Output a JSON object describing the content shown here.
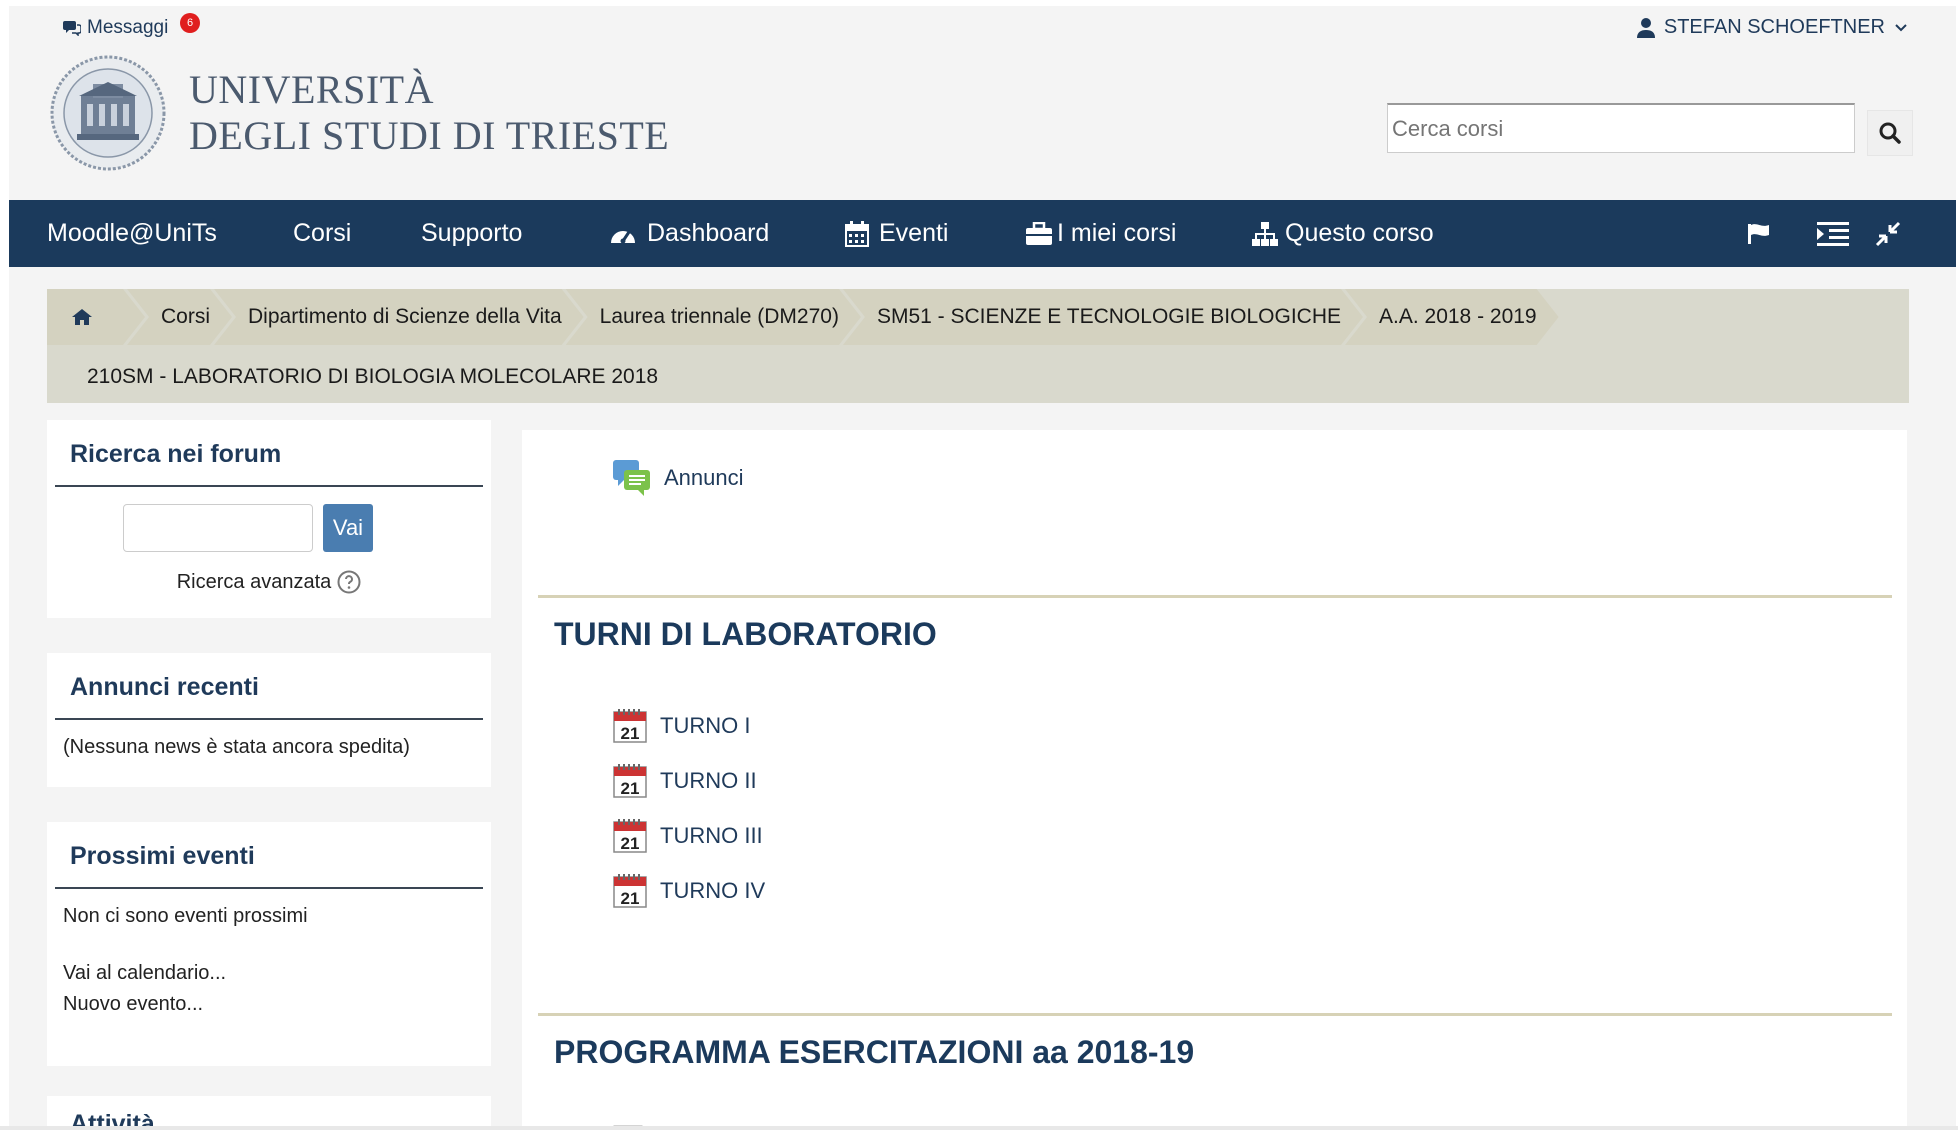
{
  "header": {
    "messages_label": "Messaggi",
    "messages_count": "6",
    "user_name": "STEFAN SCHOEFTNER",
    "logo_line1": "UNIVERSITÀ",
    "logo_line2": "DEGLI STUDI DI TRIESTE",
    "search_placeholder": "Cerca corsi"
  },
  "navbar": {
    "items": [
      {
        "label": "Moodle@UniTs",
        "icon": ""
      },
      {
        "label": "Corsi",
        "icon": ""
      },
      {
        "label": "Supporto",
        "icon": ""
      },
      {
        "label": "Dashboard",
        "icon": "dashboard-icon"
      },
      {
        "label": "Eventi",
        "icon": "calendar-icon"
      },
      {
        "label": "I miei corsi",
        "icon": "briefcase-icon"
      },
      {
        "label": "Questo corso",
        "icon": "sitemap-icon"
      }
    ],
    "right_icons": [
      "flag-icon",
      "indent-icon",
      "compress-icon"
    ]
  },
  "breadcrumb": {
    "items": [
      "Corsi",
      "Dipartimento di Scienze della Vita",
      "Laurea triennale (DM270)",
      "SM51 - SCIENZE E TECNOLOGIE BIOLOGICHE",
      "A.A. 2018 - 2019"
    ],
    "current": "210SM - LABORATORIO DI BIOLOGIA MOLECOLARE 2018"
  },
  "sidebar": {
    "forum_search": {
      "title": "Ricerca nei forum",
      "button": "Vai",
      "advanced": "Ricerca avanzata"
    },
    "recent_news": {
      "title": "Annunci recenti",
      "text": "(Nessuna news è stata ancora spedita)"
    },
    "upcoming_events": {
      "title": "Prossimi eventi",
      "text": "Non ci sono eventi prossimi",
      "link_calendar": "Vai al calendario...",
      "link_new": "Nuovo evento..."
    },
    "activities": {
      "title": "Attività"
    }
  },
  "main": {
    "announcements": "Annunci",
    "section1": {
      "title": "TURNI DI LABORATORIO",
      "items": [
        "TURNO I",
        "TURNO II",
        "TURNO III",
        "TURNO IV"
      ],
      "icon_day": "21"
    },
    "section2": {
      "title": "PROGRAMMA ESERCITAZIONI aa 2018-19"
    }
  },
  "colors": {
    "navbar": "#1b3a5c",
    "link": "#1f3a5a",
    "breadcrumb": "#d4d2c0",
    "button": "#4a7db0"
  }
}
